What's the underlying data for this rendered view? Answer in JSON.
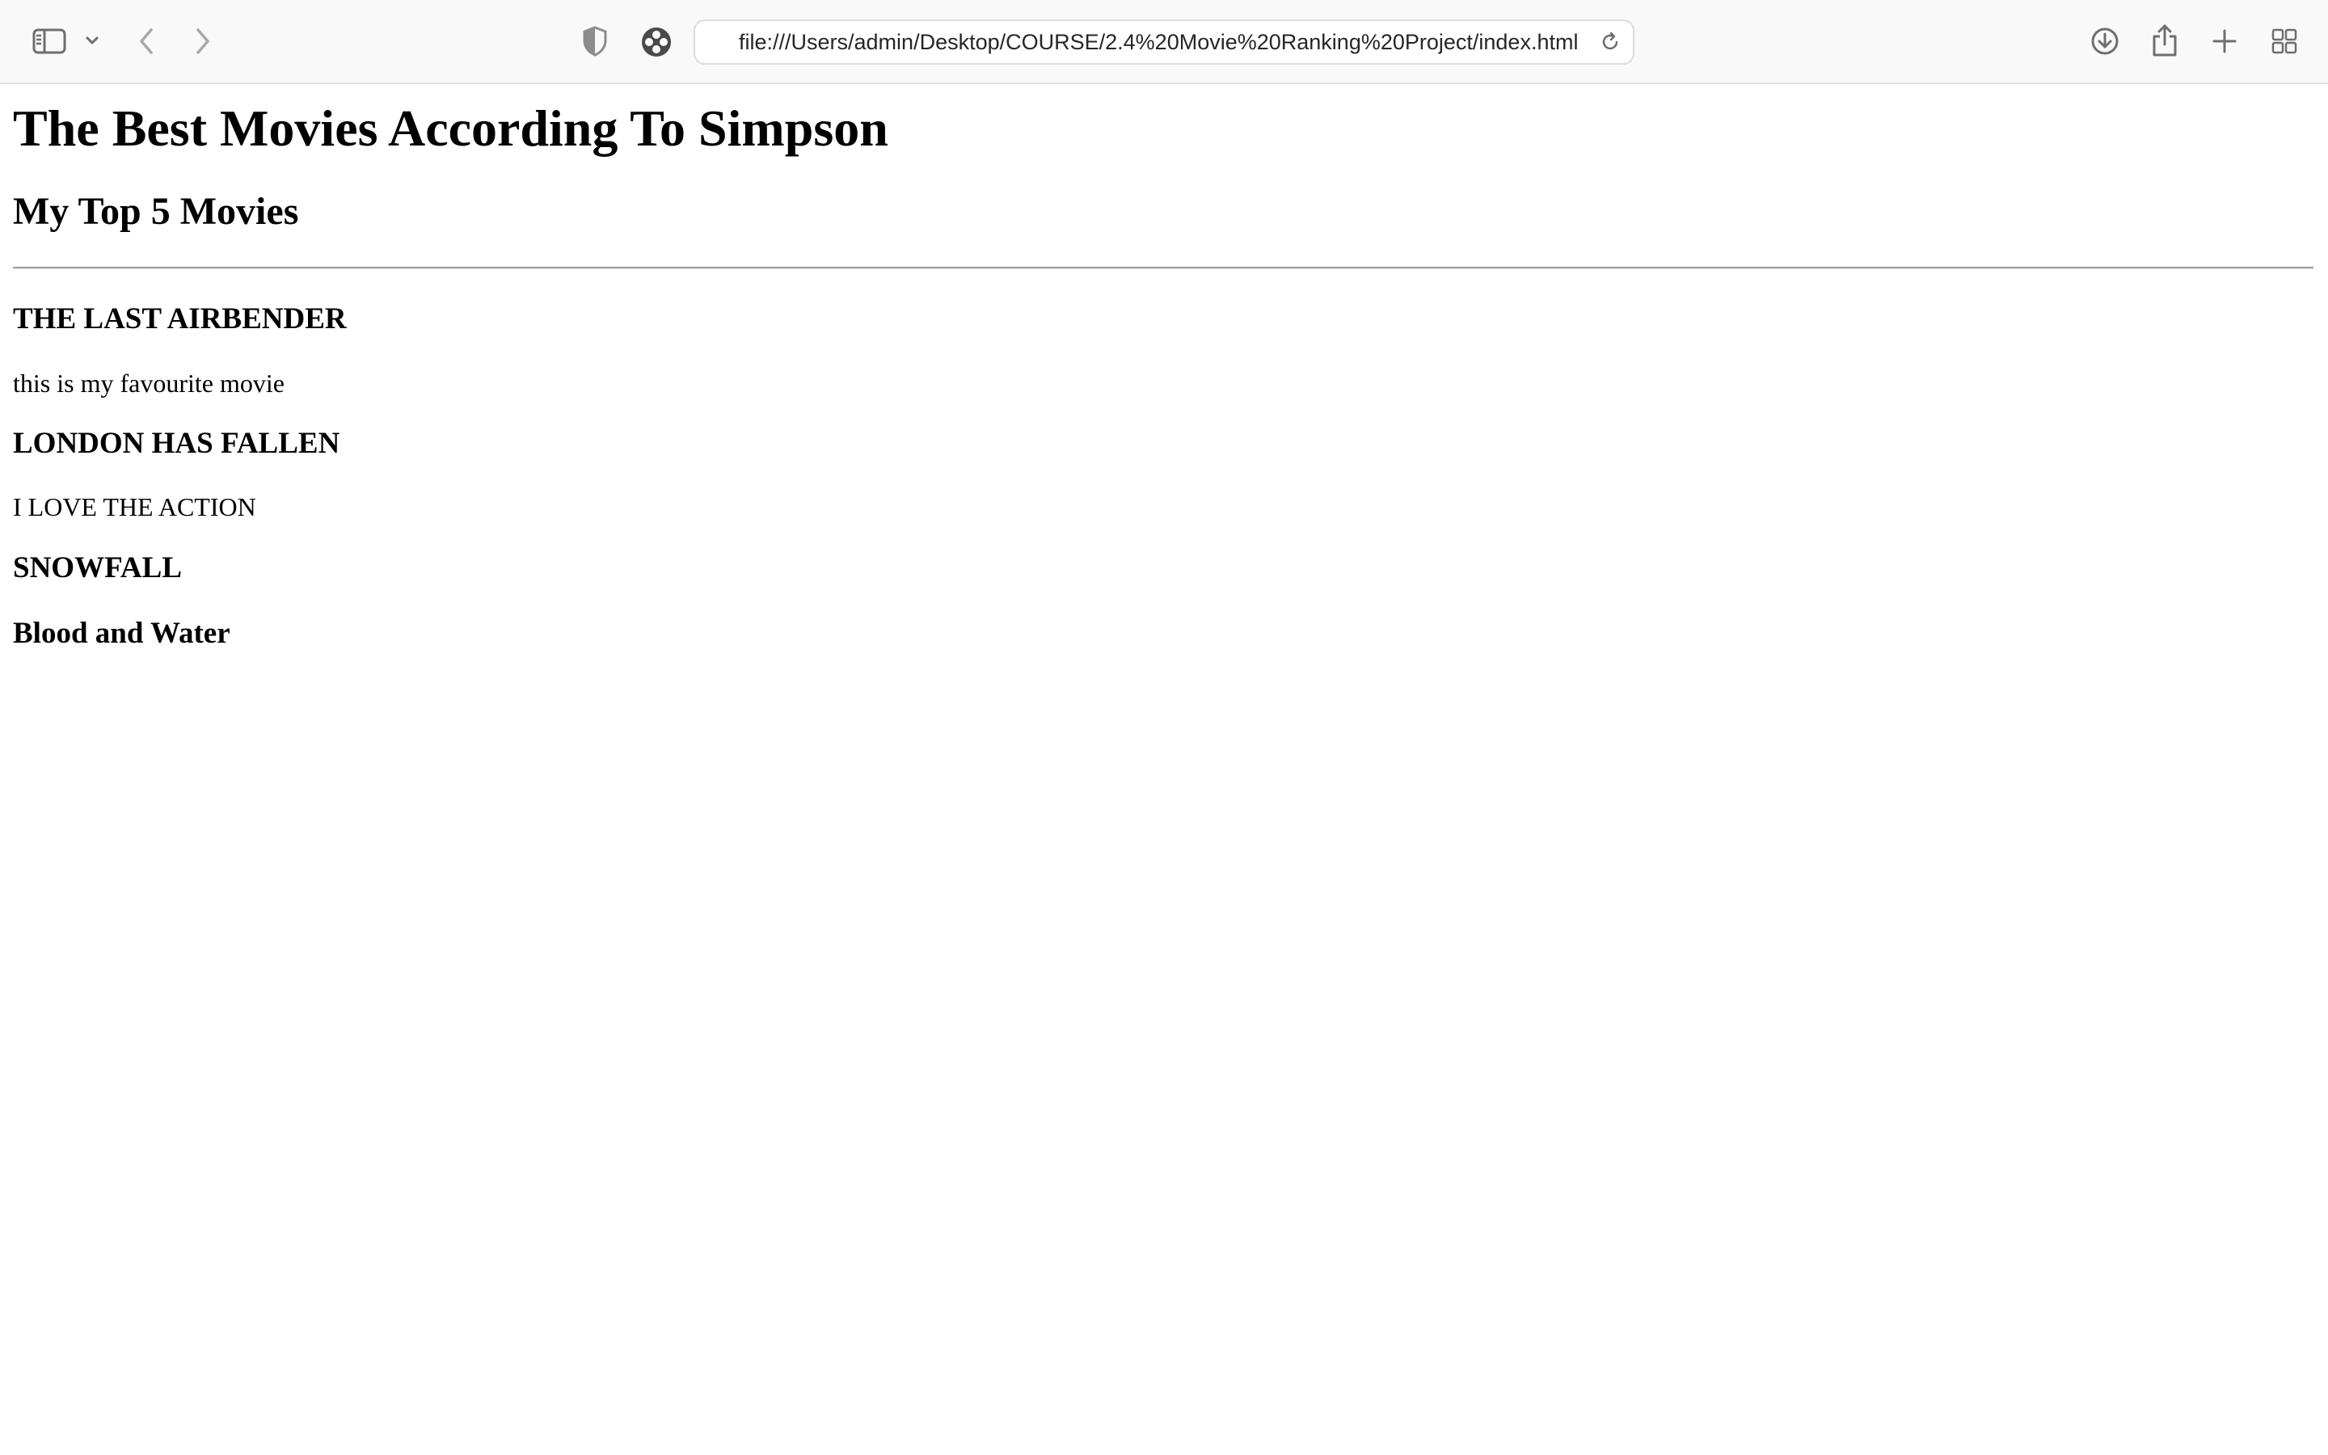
{
  "browser": {
    "address": "file:///Users/admin/Desktop/COURSE/2.4%20Movie%20Ranking%20Project/index.html",
    "icons": [
      "sidebar-icon",
      "chevron-down-icon",
      "back-arrow-icon",
      "forward-arrow-icon",
      "privacy-shield-icon",
      "extension-icon",
      "reload-icon",
      "download-icon",
      "share-icon",
      "plus-icon",
      "tab-overview-icon"
    ]
  },
  "page": {
    "title": "The Best Movies According To Simpson",
    "subtitle": "My Top 5 Movies",
    "movies": [
      {
        "title": "THE LAST AIRBENDER",
        "description": "this is my favourite movie"
      },
      {
        "title": "LONDON HAS FALLEN",
        "description": "I LOVE THE ACTION"
      },
      {
        "title": "SNOWFALL"
      },
      {
        "title": "Blood and Water"
      }
    ]
  }
}
